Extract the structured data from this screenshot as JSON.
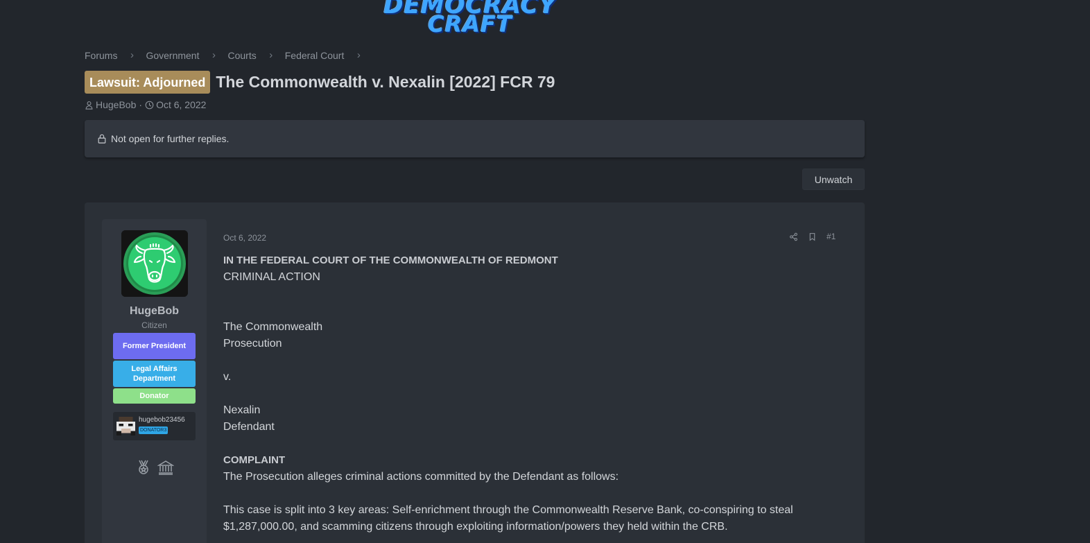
{
  "logo": {
    "line1": "DEMOCRACY",
    "line2": "CRAFT"
  },
  "breadcrumb": [
    "Forums",
    "Government",
    "Courts",
    "Federal Court"
  ],
  "thread": {
    "prefix": "Lawsuit: Adjourned",
    "title": "The Commonwealth v. Nexalin [2022] FCR 79",
    "author": "HugeBob",
    "date": "Oct 6, 2022"
  },
  "notice": {
    "text": "Not open for further replies."
  },
  "buttons": {
    "unwatch": "Unwatch"
  },
  "post": {
    "date": "Oct 6, 2022",
    "number": "#1",
    "user": {
      "name": "HugeBob",
      "title": "Citizen",
      "banners": [
        "Former President",
        "Legal Affairs Department",
        "Donator"
      ],
      "mc_name": "hugebob23456",
      "mc_rank": "DONATOR3"
    },
    "content": {
      "court_heading": "IN THE FEDERAL COURT OF THE COMMONWEALTH OF REDMONT",
      "action_type": "CRIMINAL ACTION",
      "plaintiff": "The Commonwealth",
      "plaintiff_role": "Prosecution",
      "versus": "v.",
      "defendant": "Nexalin",
      "defendant_role": "Defendant",
      "complaint_heading": "COMPLAINT",
      "complaint_intro": "The Prosecution alleges criminal actions committed by the Defendant as follows:",
      "complaint_body_line1": "This case is split into 3 key areas: Self-enrichment through the Commonwealth Reserve Bank, co-conspiring to steal",
      "complaint_body_line2": "$1,287,000.00, and scamming citizens through exploiting information/powers they held within the CRB."
    }
  },
  "colors": {
    "background": "#22262c",
    "prefix_label": "#a88c5a",
    "banner_president": "#6d6cf0",
    "banner_legal": "#38aee8",
    "banner_donator": "#8ee08a",
    "avatar_ring": "#2ecc71"
  }
}
